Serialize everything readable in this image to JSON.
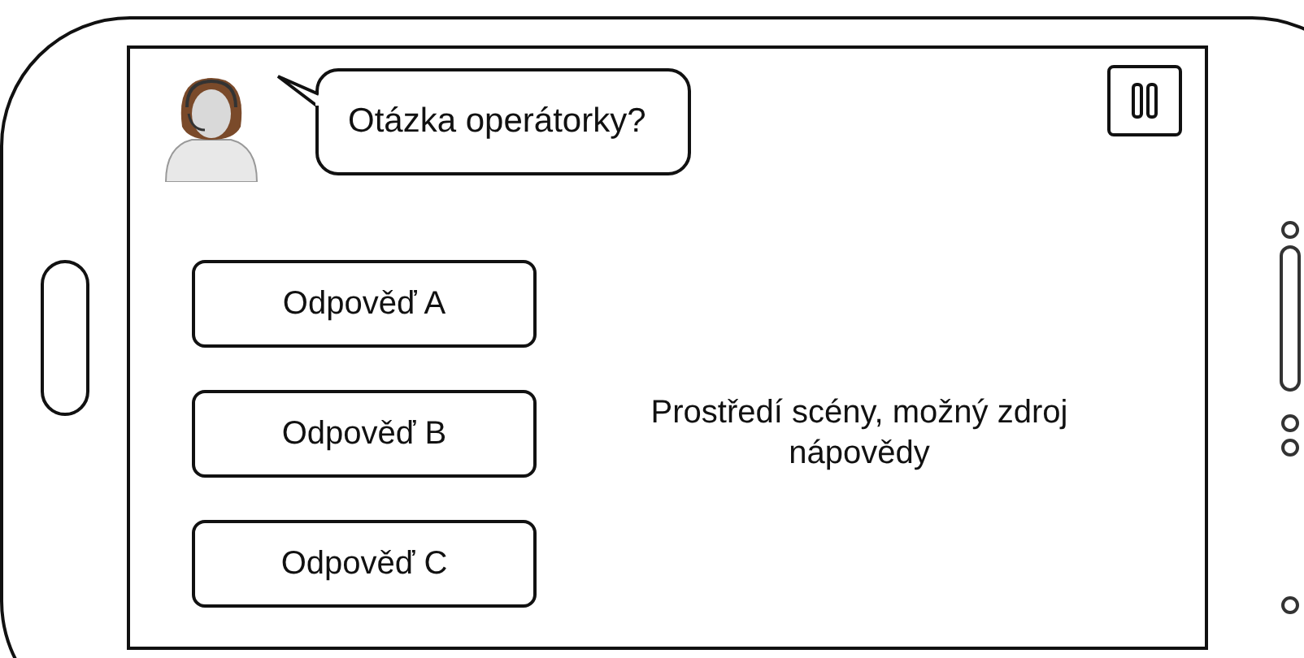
{
  "operator": {
    "question": "Otázka operátorky?"
  },
  "answers": [
    {
      "label": "Odpověď A"
    },
    {
      "label": "Odpověď B"
    },
    {
      "label": "Odpověď C"
    }
  ],
  "scene": {
    "text": "Prostředí scény, možný zdroj nápovědy"
  }
}
